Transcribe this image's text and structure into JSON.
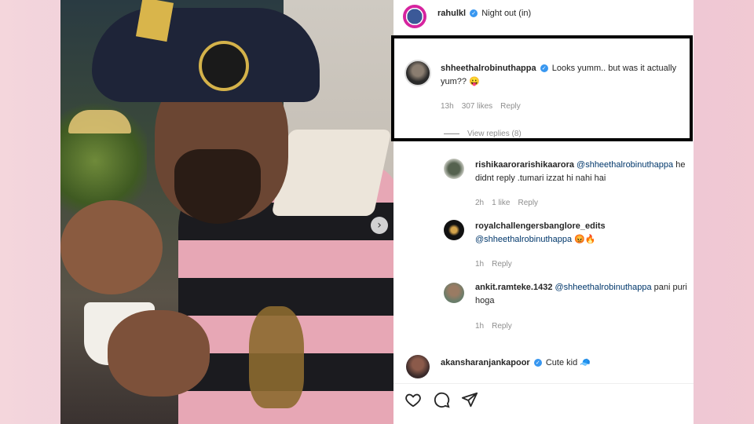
{
  "post": {
    "author": "rahulkl",
    "caption": "Night out (in)",
    "verified": true
  },
  "comments": [
    {
      "user": "shheethalrobinuthappa",
      "text": "Looks yumm.. but was it actually yum?? 😛",
      "time": "13h",
      "likes": "307 likes",
      "reply": "Reply",
      "view_replies": "View replies (8)"
    },
    {
      "user": "rishikaarorarishikaarora",
      "mention": "@shheethalrobinuthappa",
      "text": " he didnt reply .tumari izzat hi nahi hai",
      "time": "2h",
      "likes": "1 like",
      "reply": "Reply"
    },
    {
      "user": "royalchallengersbanglore_edits",
      "mention": "@shheethalrobinuthappa",
      "text": " 😡🔥",
      "time": "1h",
      "reply": "Reply"
    },
    {
      "user": "ankit.ramteke.1432",
      "mention": "@shheethalrobinuthappa",
      "text": " pani puri hoga",
      "time": "1h",
      "reply": "Reply"
    },
    {
      "user": "akansharanjankapoor",
      "text": "Cute kid 🧢"
    }
  ],
  "icons": {
    "like": "heart-icon",
    "comment": "comment-icon",
    "share": "send-icon",
    "next": "chevron-right-icon"
  },
  "colors": {
    "highlight_border": "#000000",
    "verified": "#3897f0",
    "mention": "#00376b"
  }
}
